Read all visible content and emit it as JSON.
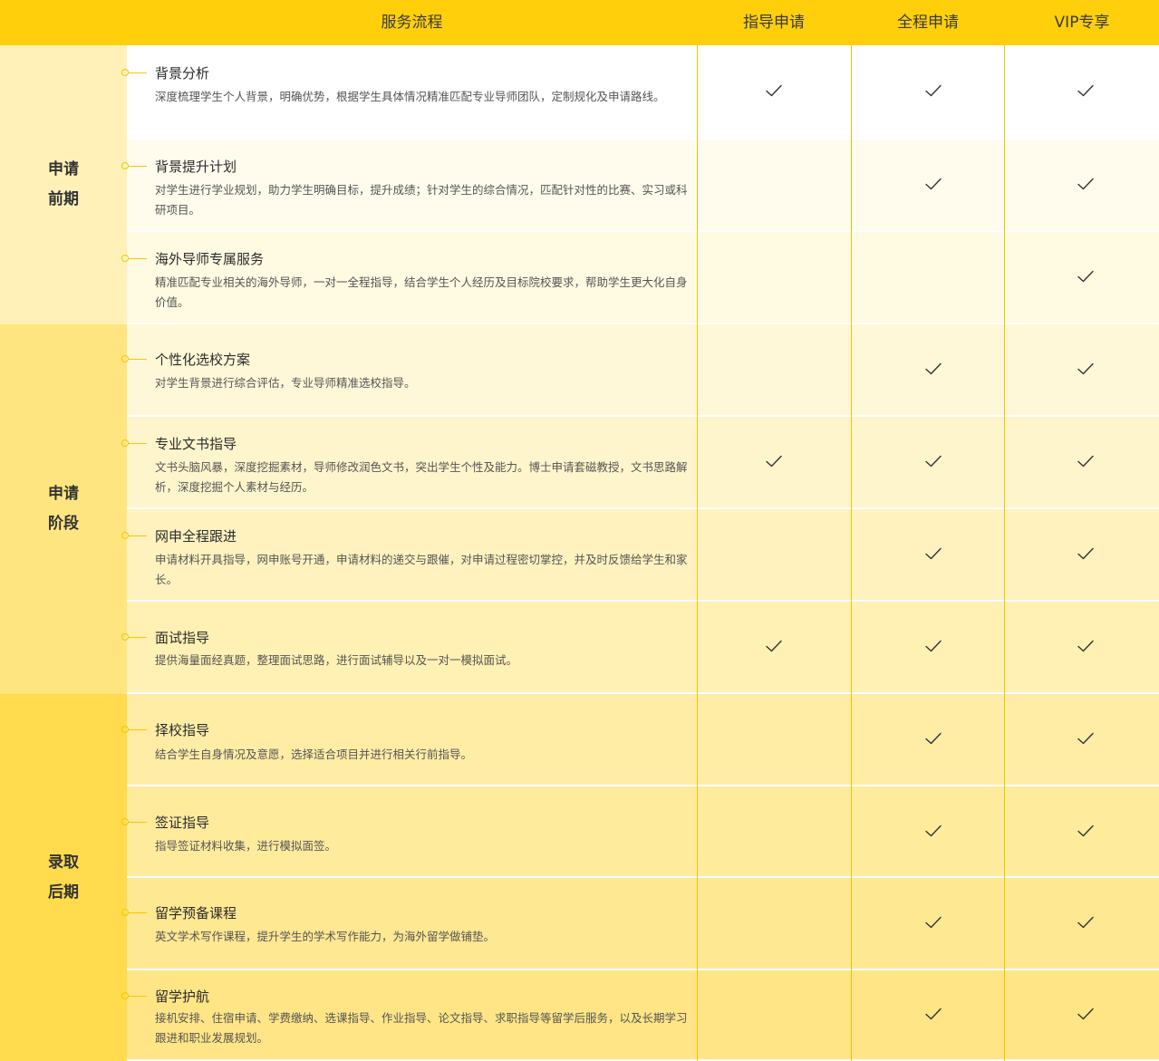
{
  "header": {
    "service": "服务流程",
    "plan1": "指导申请",
    "plan2": "全程申请",
    "plan3": "VIP专享"
  },
  "stages": [
    {
      "label": "申请\n前期"
    },
    {
      "label": "申请\n阶段"
    },
    {
      "label": "录取\n后期"
    }
  ],
  "rows": [
    {
      "title": "背景分析",
      "desc": "深度梳理学生个人背景，明确优势，根据学生具体情况精准匹配专业导师团队，定制规化及申请路线。",
      "plan1": true,
      "plan2": true,
      "plan3": true
    },
    {
      "title": "背景提升计划",
      "desc": "对学生进行学业规划，助力学生明确目标，提升成绩；针对学生的综合情况，匹配针对性的比赛、实习或科研项目。",
      "plan1": false,
      "plan2": true,
      "plan3": true
    },
    {
      "title": "海外导师专属服务",
      "desc": "精准匹配专业相关的海外导师，一对一全程指导，结合学生个人经历及目标院校要求，帮助学生更大化自身价值。",
      "plan1": false,
      "plan2": false,
      "plan3": true
    },
    {
      "title": "个性化选校方案",
      "desc": "对学生背景进行综合评估，专业导师精准选校指导。",
      "plan1": false,
      "plan2": true,
      "plan3": true
    },
    {
      "title": "专业文书指导",
      "desc": "文书头脑风暴，深度挖掘素材，导师修改润色文书，突出学生个性及能力。博士申请套磁教授，文书思路解析，深度挖掘个人素材与经历。",
      "plan1": true,
      "plan2": true,
      "plan3": true
    },
    {
      "title": "网申全程跟进",
      "desc": "申请材料开具指导，网申账号开通，申请材料的递交与跟催，对申请过程密切掌控，并及时反馈给学生和家长。",
      "plan1": false,
      "plan2": true,
      "plan3": true
    },
    {
      "title": "面试指导",
      "desc": "提供海量面经真题，整理面试思路，进行面试辅导以及一对一模拟面试。",
      "plan1": true,
      "plan2": true,
      "plan3": true
    },
    {
      "title": "择校指导",
      "desc": "结合学生自身情况及意愿，选择适合项目并进行相关行前指导。",
      "plan1": false,
      "plan2": true,
      "plan3": true
    },
    {
      "title": "签证指导",
      "desc": "指导签证材料收集，进行模拟面签。",
      "plan1": false,
      "plan2": true,
      "plan3": true
    },
    {
      "title": "留学预备课程",
      "desc": "英文学术写作课程，提升学生的学术写作能力，为海外留学做铺垫。",
      "plan1": false,
      "plan2": true,
      "plan3": true
    },
    {
      "title": "留学护航",
      "desc": "接机安排、住宿申请、学费缴纳、选课指导、作业指导、论文指导、求职指导等留学后服务，以及长期学习跟进和职业发展规划。",
      "plan1": false,
      "plan2": true,
      "plan3": true
    }
  ]
}
